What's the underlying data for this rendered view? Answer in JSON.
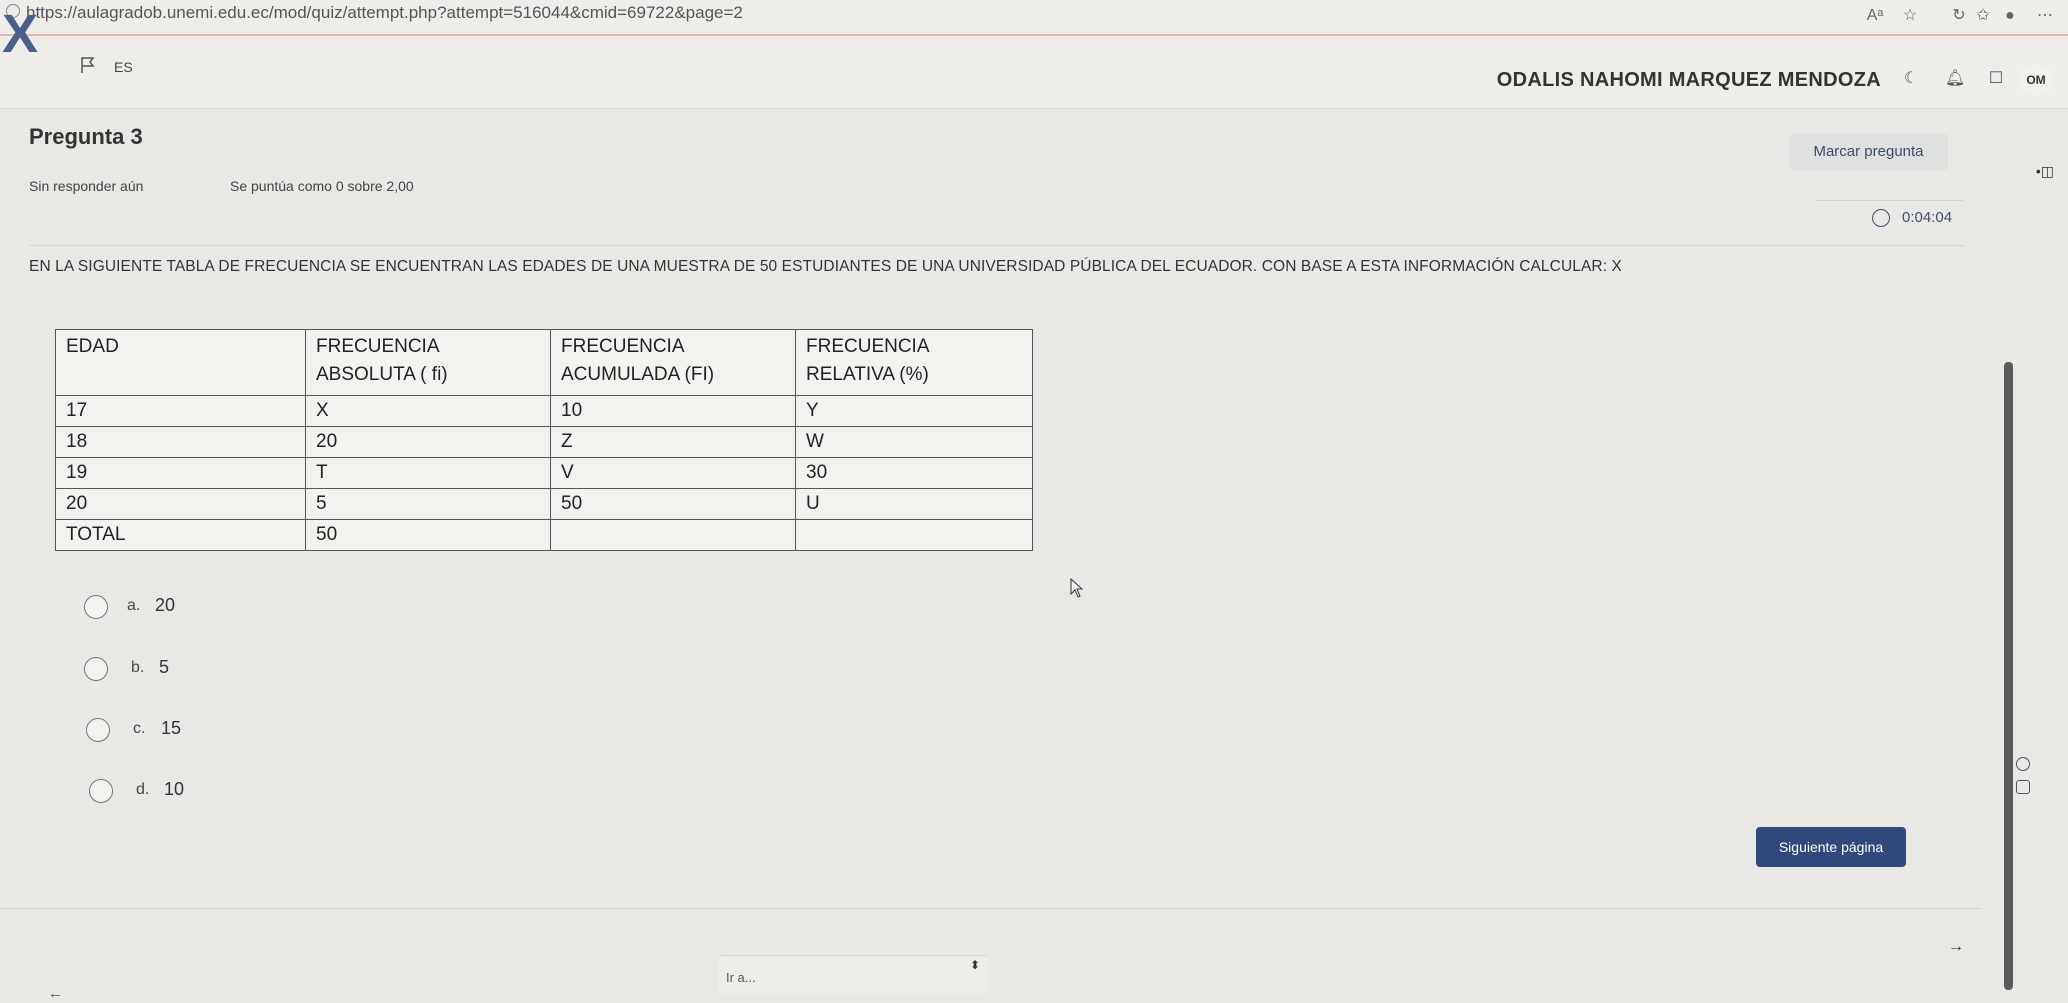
{
  "browser": {
    "url": "https://aulagradob.unemi.edu.ec/mod/quiz/attempt.php?attempt=516044&cmid=69722&page=2",
    "icons": [
      "lock-icon",
      "read-aloud-icon",
      "favorite-icon",
      "refresh-icon",
      "favorites-list-icon",
      "profile-icon",
      "more-icon"
    ]
  },
  "header": {
    "logo": "X",
    "language": "ES",
    "user_name": "ODALIS NAHOMI MARQUEZ MENDOZA",
    "avatar_initials": "OM",
    "icons": [
      "flag-icon",
      "bell-icon",
      "chat-icon"
    ]
  },
  "question": {
    "title": "Pregunta 3",
    "status": "Sin responder aún",
    "grade": "Se puntúa como 0 sobre 2,00",
    "flag_label": "Marcar pregunta",
    "timer": "0:04:04",
    "text": "EN LA SIGUIENTE TABLA DE FRECUENCIA SE ENCUENTRAN LAS EDADES DE UNA MUESTRA DE 50 ESTUDIANTES DE UNA UNIVERSIDAD PÚBLICA DEL ECUADOR. CON BASE A ESTA INFORMACIÓN CALCULAR: X"
  },
  "table": {
    "headers": [
      [
        "EDAD",
        ""
      ],
      [
        "FRECUENCIA",
        "ABSOLUTA ( fi)"
      ],
      [
        "FRECUENCIA",
        "ACUMULADA (FI)"
      ],
      [
        "FRECUENCIA",
        "RELATIVA (%)"
      ]
    ],
    "rows": [
      [
        "17",
        "X",
        "10",
        "Y"
      ],
      [
        "18",
        "20",
        "Z",
        "W"
      ],
      [
        "19",
        "T",
        "V",
        "30"
      ],
      [
        "20",
        "5",
        "50",
        "U"
      ],
      [
        "TOTAL",
        "50",
        "",
        ""
      ]
    ]
  },
  "answers": [
    {
      "letter": "a.",
      "value": "20"
    },
    {
      "letter": "b.",
      "value": "5"
    },
    {
      "letter": "c.",
      "value": "15"
    },
    {
      "letter": "d.",
      "value": "10"
    }
  ],
  "navigation": {
    "next_label": "Siguiente página",
    "goto_placeholder": "Ir a...",
    "prev_arrow": "←",
    "next_arrow": "→"
  },
  "colors": {
    "primary": "#2f4a7a",
    "background": "#e9e8e5"
  }
}
